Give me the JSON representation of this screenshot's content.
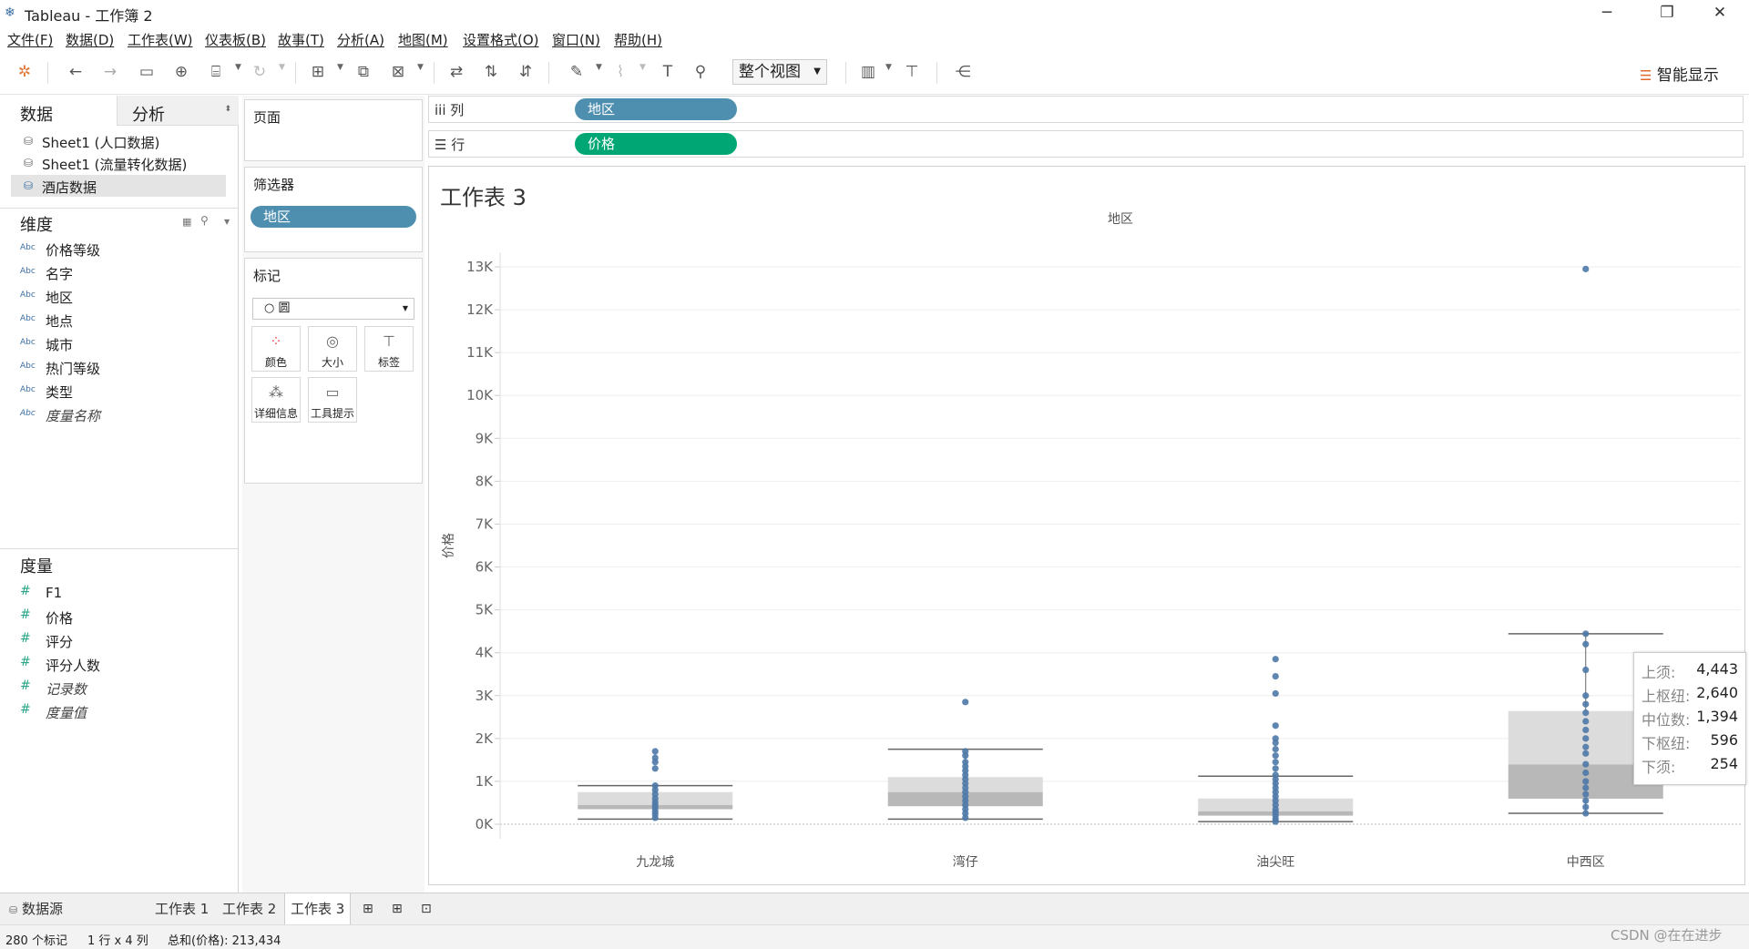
{
  "window": {
    "title": "Tableau - 工作簿 2",
    "minimize": "─",
    "restore": "❐",
    "close": "✕"
  },
  "menu": [
    "文件(F)",
    "数据(D)",
    "工作表(W)",
    "仪表板(B)",
    "故事(T)",
    "分析(A)",
    "地图(M)",
    "设置格式(O)",
    "窗口(N)",
    "帮助(H)"
  ],
  "toolbar": {
    "fit": "整个视图",
    "show_me": "智能显示"
  },
  "left": {
    "tab_data": "数据",
    "tab_analysis": "分析",
    "datasources": [
      "Sheet1 (人口数据)",
      "Sheet1 (流量转化数据)",
      "酒店数据"
    ],
    "dimensions_title": "维度",
    "dimensions": [
      "价格等级",
      "名字",
      "地区",
      "地点",
      "城市",
      "热门等级",
      "类型",
      "度量名称"
    ],
    "dim_icon": "Abc",
    "measures_title": "度量",
    "measures": [
      "F1",
      "价格",
      "评分",
      "评分人数",
      "记录数",
      "度量值"
    ],
    "measure_icon": "#"
  },
  "cards": {
    "pages": "页面",
    "filters": "筛选器",
    "filter_pill": "地区",
    "marks": "标记",
    "mark_type": "○ 圆",
    "mark_buttons": [
      "颜色",
      "大小",
      "标签",
      "详细信息",
      "工具提示"
    ]
  },
  "shelves": {
    "cols_label": "iii 列",
    "rows_label": "☰ 行",
    "cols_pill": "地区",
    "rows_pill": "价格"
  },
  "sheet": {
    "title": "工作表 3"
  },
  "chart_data": {
    "type": "scatter",
    "subtype": "box-plot with jittered points",
    "xlabel": "地区",
    "ylabel": "价格",
    "categories": [
      "九龙城",
      "湾仔",
      "油尖旺",
      "中西区"
    ],
    "ylim": [
      0,
      13000
    ],
    "y_ticks": [
      "0K",
      "1K",
      "2K",
      "3K",
      "4K",
      "5K",
      "6K",
      "7K",
      "8K",
      "9K",
      "10K",
      "11K",
      "12K",
      "13K"
    ],
    "grid": true,
    "boxes": [
      {
        "category": "九龙城",
        "lower_whisker": 120,
        "lower_hinge": 350,
        "median": 450,
        "upper_hinge": 750,
        "upper_whisker": 900
      },
      {
        "category": "湾仔",
        "lower_whisker": 120,
        "lower_hinge": 420,
        "median": 750,
        "upper_hinge": 1100,
        "upper_whisker": 1750
      },
      {
        "category": "油尖旺",
        "lower_whisker": 60,
        "lower_hinge": 200,
        "median": 300,
        "upper_hinge": 600,
        "upper_whisker": 1120
      },
      {
        "category": "中西区",
        "lower_whisker": 254,
        "lower_hinge": 596,
        "median": 1394,
        "upper_hinge": 2640,
        "upper_whisker": 4443
      }
    ],
    "points": [
      {
        "category": "九龙城",
        "values": [
          150,
          230,
          300,
          380,
          450,
          520,
          600,
          700,
          800,
          900,
          1300,
          1450,
          1550,
          1700
        ]
      },
      {
        "category": "湾仔",
        "values": [
          150,
          250,
          350,
          450,
          550,
          650,
          750,
          850,
          950,
          1050,
          1150,
          1250,
          1350,
          1450,
          1600,
          1700,
          2850
        ]
      },
      {
        "category": "油尖旺",
        "values": [
          60,
          120,
          200,
          280,
          350,
          450,
          550,
          650,
          750,
          850,
          950,
          1050,
          1150,
          1300,
          1450,
          1600,
          1750,
          1900,
          2000,
          2300,
          3050,
          3450,
          3850
        ]
      },
      {
        "category": "中西区",
        "values": [
          254,
          400,
          550,
          700,
          850,
          1000,
          1200,
          1400,
          1650,
          1800,
          2000,
          2200,
          2400,
          2600,
          2800,
          3000,
          3600,
          4200,
          4443,
          12950
        ]
      }
    ],
    "tooltip": [
      {
        "k": "上须:",
        "v": "4,443"
      },
      {
        "k": "上枢纽:",
        "v": "2,640"
      },
      {
        "k": "中位数:",
        "v": "1,394"
      },
      {
        "k": "下枢纽:",
        "v": "596"
      },
      {
        "k": "下须:",
        "v": "254"
      }
    ],
    "colors": {
      "point": "#4e79a7",
      "box_upper": "#dcdcdc",
      "box_lower": "#b8b8b8",
      "whisker": "#666666"
    }
  },
  "sheet_tabs": {
    "datasource": "数据源",
    "tabs": [
      "工作表 1",
      "工作表 2",
      "工作表 3"
    ],
    "active": "工作表 3"
  },
  "status": {
    "marks": "280 个标记",
    "dims": "1 行 x 4 列",
    "sum": "总和(价格): 213,434"
  },
  "watermark": "CSDN @在在进步"
}
